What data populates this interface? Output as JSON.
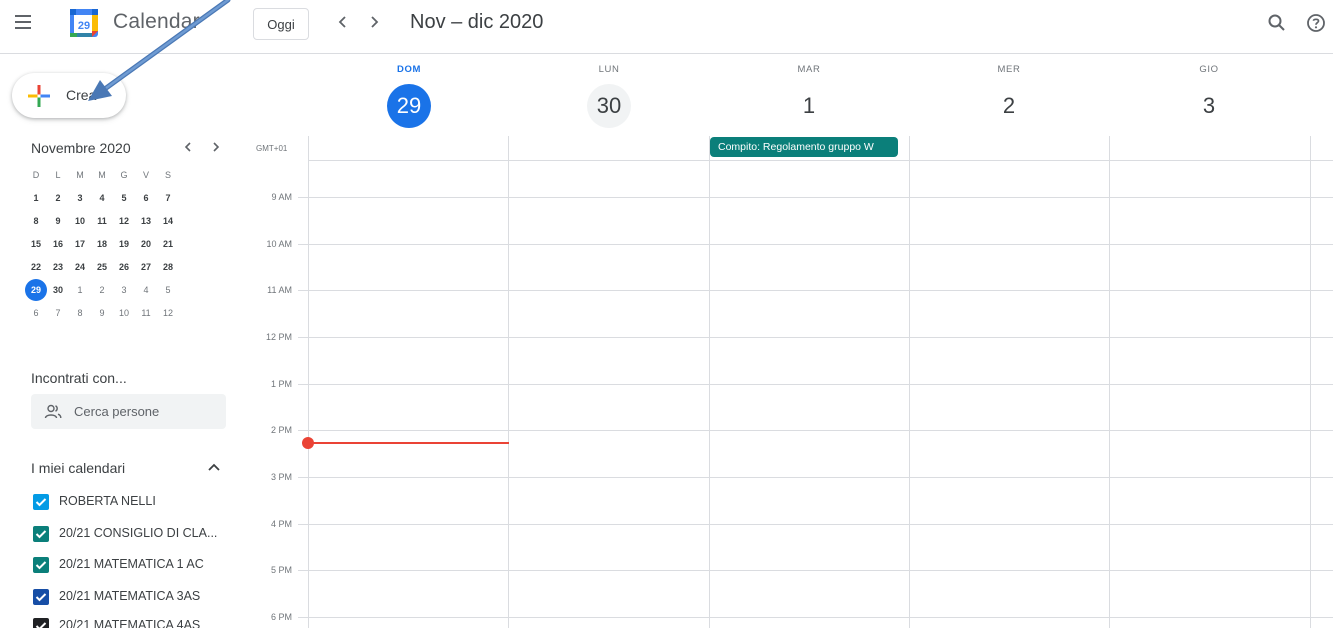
{
  "header": {
    "app_title": "Calendar",
    "logo_day": "29",
    "today_label": "Oggi",
    "date_range": "Nov – dic 2020",
    "icons": [
      "menu-icon",
      "search-icon",
      "help-icon",
      "chevron-left-icon",
      "chevron-right-icon"
    ]
  },
  "create_button": {
    "label": "Crea"
  },
  "mini_calendar": {
    "title": "Novembre 2020",
    "weekdays": [
      "D",
      "L",
      "M",
      "M",
      "G",
      "V",
      "S"
    ],
    "weeks": [
      [
        "1",
        "2",
        "3",
        "4",
        "5",
        "6",
        "7"
      ],
      [
        "8",
        "9",
        "10",
        "11",
        "12",
        "13",
        "14"
      ],
      [
        "15",
        "16",
        "17",
        "18",
        "19",
        "20",
        "21"
      ],
      [
        "22",
        "23",
        "24",
        "25",
        "26",
        "27",
        "28"
      ],
      [
        "29",
        "30",
        "1",
        "2",
        "3",
        "4",
        "5"
      ],
      [
        "6",
        "7",
        "8",
        "9",
        "10",
        "11",
        "12"
      ]
    ],
    "selected": "29"
  },
  "meet_with": {
    "title": "Incontrati con...",
    "search_placeholder": "Cerca persone"
  },
  "my_calendars": {
    "title": "I miei calendari",
    "items": [
      {
        "name": "ROBERTA NELLI",
        "color": "#039be5"
      },
      {
        "name": "20/21 CONSIGLIO DI CLA...",
        "color": "#0b8043"
      },
      {
        "name": "20/21 MATEMATICA 1 AC",
        "color": "#0b8043"
      },
      {
        "name": "20/21 MATEMATICA 3AS",
        "color": "#174ea6"
      },
      {
        "name": "20/21 MATEMATICA 4AS",
        "color": "#202124"
      }
    ]
  },
  "week_view": {
    "timezone": "GMT+01",
    "days": [
      {
        "abbr": "DOM",
        "num": "29",
        "today": true
      },
      {
        "abbr": "LUN",
        "num": "30",
        "today": false
      },
      {
        "abbr": "MAR",
        "num": "1",
        "today": false
      },
      {
        "abbr": "MER",
        "num": "2",
        "today": false
      },
      {
        "abbr": "GIO",
        "num": "3",
        "today": false
      }
    ],
    "hours": [
      "9 AM",
      "10 AM",
      "11 AM",
      "12 PM",
      "1 PM",
      "2 PM",
      "3 PM",
      "4 PM",
      "5 PM",
      "6 PM"
    ],
    "all_day_event": {
      "title": "Compito: Regolamento gruppo W",
      "color": "#0b7f7a"
    }
  },
  "colors": {
    "accent": "#1a73e8",
    "now_line": "#ea4335"
  }
}
